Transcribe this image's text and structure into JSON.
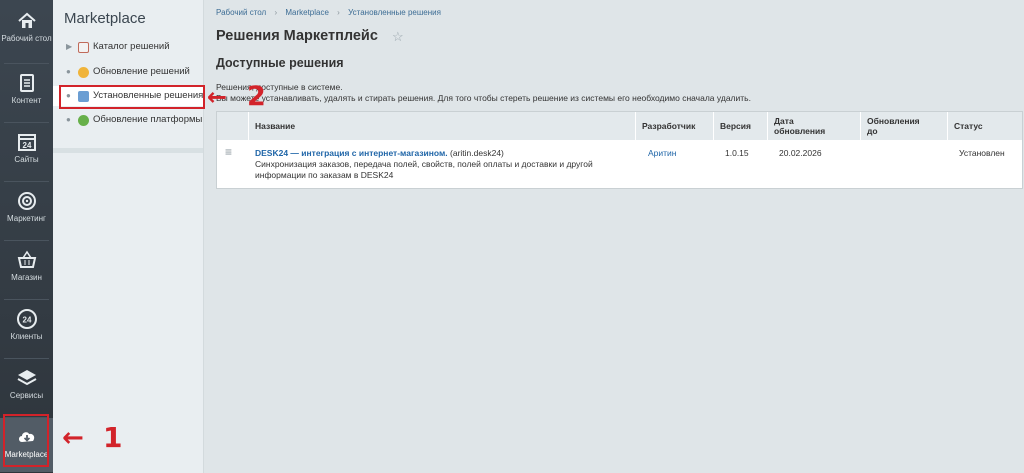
{
  "rail": {
    "items": [
      {
        "label": "Рабочий стол",
        "icon": "home-icon"
      },
      {
        "label": "Контент",
        "icon": "document-icon"
      },
      {
        "label": "Сайты",
        "icon": "calendar-icon"
      },
      {
        "label": "Маркетинг",
        "icon": "target-icon"
      },
      {
        "label": "Магазин",
        "icon": "basket-icon"
      },
      {
        "label": "Клиенты",
        "icon": "clients-24-icon"
      },
      {
        "label": "Сервисы",
        "icon": "layers-icon"
      },
      {
        "label": "Marketplace",
        "icon": "cloud-download-icon"
      }
    ],
    "calendar_digit": "24",
    "clients_digit": "24"
  },
  "subpanel": {
    "title": "Marketplace",
    "items": [
      {
        "label": "Каталог решений"
      },
      {
        "label": "Обновление решений"
      },
      {
        "label": "Установленные решения"
      },
      {
        "label": "Обновление платформы"
      }
    ]
  },
  "main": {
    "breadcrumbs": [
      "Рабочий стол",
      "Marketplace",
      "Установленные решения"
    ],
    "breadcrumb_sep": "›",
    "title": "Решения Маркетплейс",
    "star": "☆",
    "section_title": "Доступные решения",
    "desc_line1": "Решения, доступные в системе.",
    "desc_line2": "Вы можете устанавливать, удалять и стирать решения. Для того чтобы стереть решение из системы его необходимо сначала удалить."
  },
  "table": {
    "headers": {
      "name": "Название",
      "developer": "Разработчик",
      "version": "Версия",
      "date_line1": "Дата",
      "date_line2": "обновления",
      "updates_line1": "Обновления",
      "updates_line2": "до",
      "status": "Статус"
    },
    "rows": [
      {
        "menu": "≡",
        "name": "DESK24 — интеграция с интернет-магазином.",
        "code": "(aritin.desk24)",
        "description_line1": "Синхронизация заказов, передача полей, свойств, полей оплаты и доставки и другой",
        "description_line2": "информации по заказам в DESK24",
        "developer": "Аритин",
        "version": "1.0.15",
        "date": "20.02.2026",
        "updates_until": "",
        "status": "Установлен"
      }
    ]
  },
  "annotations": {
    "arrow1": "←",
    "label1": "1",
    "arrow2": "←",
    "label2": "2",
    "color": "#d2232a"
  }
}
